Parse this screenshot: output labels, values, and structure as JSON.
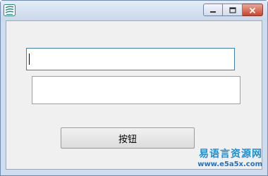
{
  "window": {
    "icon": "app-icon",
    "controls": [
      "minimize-icon",
      "maximize-icon",
      "close-icon"
    ]
  },
  "form": {
    "input1": {
      "value": ""
    },
    "input2": {
      "value": ""
    },
    "button": {
      "label": "按钮"
    }
  },
  "watermark": {
    "chinese": "易语言资源网",
    "url": "www.e5a5x.com"
  },
  "colors": {
    "client_background": "#f0f0f0",
    "focus_border": "#3c7fb1",
    "close_button": "#c9442a",
    "watermark": "#1e8fd3"
  }
}
